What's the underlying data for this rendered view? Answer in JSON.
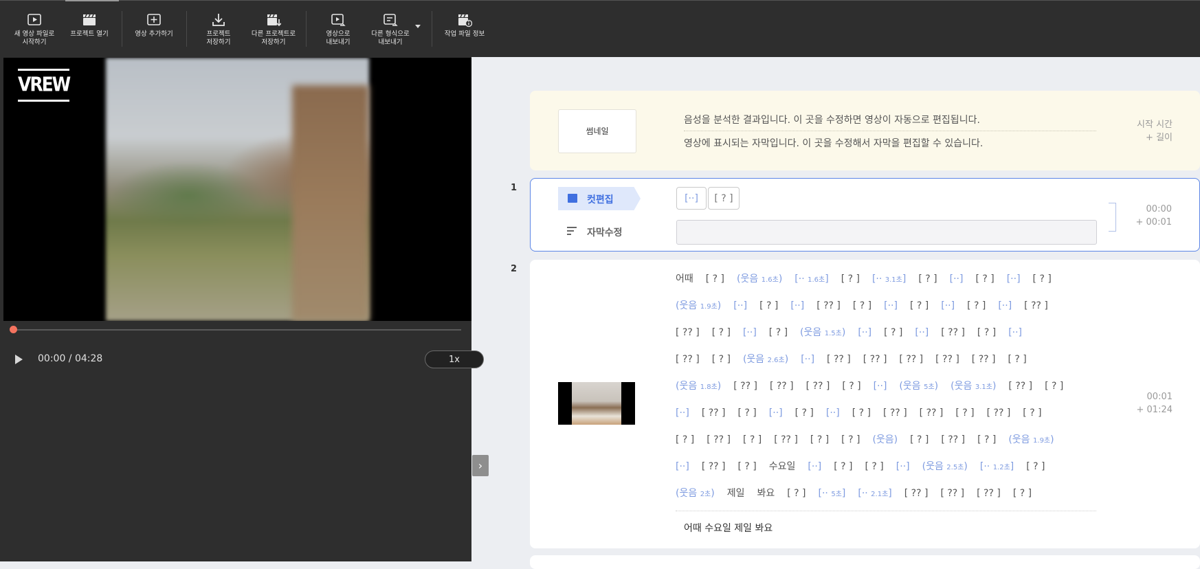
{
  "toolbar": {
    "items": [
      {
        "name": "new-video-button",
        "label": "새 영상 파일로\n시작하기",
        "icon": "play-box-icon"
      },
      {
        "name": "open-project-button",
        "label": "프로젝트 열기",
        "icon": "clapper-icon"
      },
      {
        "name": "add-video-button",
        "label": "영상 추가하기",
        "icon": "plus-box-icon"
      },
      {
        "name": "save-project-button",
        "label": "프로젝트\n저장하기",
        "icon": "download-icon"
      },
      {
        "name": "save-as-button",
        "label": "다른 프로젝트로\n저장하기",
        "icon": "clapper-download-icon"
      },
      {
        "name": "export-video-button",
        "label": "영상으로\n내보내기",
        "icon": "export-video-icon"
      },
      {
        "name": "export-other-button",
        "label": "다른 형식으로\n내보내기",
        "icon": "export-format-icon"
      },
      {
        "name": "project-info-button",
        "label": "작업 파일 정보",
        "icon": "clapper-info-icon"
      }
    ]
  },
  "player": {
    "logo": "VREW",
    "time": "00:00 / 04:28",
    "speed": "1x",
    "progress": 0
  },
  "header": {
    "thumbnail_label": "썸네일",
    "line1": "음성을 분석한 결과입니다. 이 곳을 수정하면 영상이 자동으로 편집됩니다.",
    "line2": "영상에 표시되는 자막입니다. 이 곳을 수정해서 자막을 편집할 수 있습니다.",
    "start_time": "시작 시간",
    "length": "+ 길이"
  },
  "clip1": {
    "number": "1",
    "cut_label": "컷편집",
    "subtitle_label": "자막수정",
    "chips": [
      "[··]",
      "[ ? ]"
    ],
    "start": "00:00",
    "length": "+ 00:01"
  },
  "clip2": {
    "number": "2",
    "start": "00:01",
    "length": "+ 01:24",
    "subtitle": "어때 수요일 제일 봐요",
    "lines": [
      [
        [
          "어때",
          ""
        ],
        [
          "[ ? ]",
          ""
        ],
        [
          "(웃음 |1.6초|)",
          "g"
        ],
        [
          "[·· |1.6초|]",
          "g"
        ],
        [
          "[ ? ]",
          ""
        ],
        [
          "[·· |3.1초|]",
          "g"
        ],
        [
          "[ ? ]",
          ""
        ],
        [
          "[··]",
          "g"
        ],
        [
          "[ ? ]",
          ""
        ],
        [
          "[··]",
          "g"
        ],
        [
          "[ ? ]",
          ""
        ]
      ],
      [
        [
          "(웃음 |1.9초|)",
          "g"
        ],
        [
          "[··]",
          "g"
        ],
        [
          "[ ? ]",
          ""
        ],
        [
          "[··]",
          "g"
        ],
        [
          "[ ?? ]",
          ""
        ],
        [
          "[ ? ]",
          ""
        ],
        [
          "[··]",
          "g"
        ],
        [
          "[ ? ]",
          ""
        ],
        [
          "[··]",
          "g"
        ],
        [
          "[ ? ]",
          ""
        ],
        [
          "[··]",
          "g"
        ],
        [
          "[ ?? ]",
          ""
        ]
      ],
      [
        [
          "[ ?? ]",
          ""
        ],
        [
          "[ ? ]",
          ""
        ],
        [
          "[··]",
          "g"
        ],
        [
          "[ ? ]",
          ""
        ],
        [
          "(웃음 |1.5초|)",
          "g"
        ],
        [
          "[··]",
          "g"
        ],
        [
          "[ ? ]",
          ""
        ],
        [
          "[··]",
          "g"
        ],
        [
          "[ ?? ]",
          ""
        ],
        [
          "[ ? ]",
          ""
        ],
        [
          "[··]",
          "g"
        ]
      ],
      [
        [
          "[ ?? ]",
          ""
        ],
        [
          "[ ? ]",
          ""
        ],
        [
          "(웃음 |2.6초|)",
          "g"
        ],
        [
          "[··]",
          "g"
        ],
        [
          "[ ?? ]",
          ""
        ],
        [
          "[ ?? ]",
          ""
        ],
        [
          "[ ?? ]",
          ""
        ],
        [
          "[ ?? ]",
          ""
        ],
        [
          "[ ?? ]",
          ""
        ],
        [
          "[ ? ]",
          ""
        ]
      ],
      [
        [
          "(웃음 |1.8초|)",
          "g"
        ],
        [
          "[ ?? ]",
          ""
        ],
        [
          "[ ?? ]",
          ""
        ],
        [
          "[ ?? ]",
          ""
        ],
        [
          "[ ? ]",
          ""
        ],
        [
          "[··]",
          "g"
        ],
        [
          "(웃음 |5초|)",
          "g"
        ],
        [
          "(웃음 |3.1초|)",
          "g"
        ],
        [
          "[ ?? ]",
          ""
        ],
        [
          "[ ? ]",
          ""
        ]
      ],
      [
        [
          "[··]",
          "g"
        ],
        [
          "[ ?? ]",
          ""
        ],
        [
          "[ ? ]",
          ""
        ],
        [
          "[··]",
          "g"
        ],
        [
          "[ ? ]",
          ""
        ],
        [
          "[··]",
          "g"
        ],
        [
          "[ ? ]",
          ""
        ],
        [
          "[ ?? ]",
          ""
        ],
        [
          "[ ?? ]",
          ""
        ],
        [
          "[ ? ]",
          ""
        ],
        [
          "[ ?? ]",
          ""
        ],
        [
          "[ ? ]",
          ""
        ]
      ],
      [
        [
          "[ ? ]",
          ""
        ],
        [
          "[ ?? ]",
          ""
        ],
        [
          "[ ? ]",
          ""
        ],
        [
          "[ ?? ]",
          ""
        ],
        [
          "[ ? ]",
          ""
        ],
        [
          "[ ? ]",
          ""
        ],
        [
          "(웃음)",
          "g"
        ],
        [
          "[ ? ]",
          ""
        ],
        [
          "[ ?? ]",
          ""
        ],
        [
          "[ ? ]",
          ""
        ],
        [
          "(웃음 |1.9초|)",
          "g"
        ]
      ],
      [
        [
          "[··]",
          "g"
        ],
        [
          "[ ?? ]",
          ""
        ],
        [
          "[ ? ]",
          ""
        ],
        [
          "수요일",
          ""
        ],
        [
          "[··]",
          "g"
        ],
        [
          "[ ? ]",
          ""
        ],
        [
          "[ ? ]",
          ""
        ],
        [
          "[··]",
          "g"
        ],
        [
          "(웃음 |2.5초|)",
          "g"
        ],
        [
          "[·· |1.2초|]",
          "g"
        ],
        [
          "[ ? ]",
          ""
        ]
      ],
      [
        [
          "(웃음 |2초|)",
          "g"
        ],
        [
          "제일",
          ""
        ],
        [
          "봐요",
          ""
        ],
        [
          "[ ? ]",
          ""
        ],
        [
          "[·· |5초|]",
          "g"
        ],
        [
          "[·· |2.1초|]",
          "g"
        ],
        [
          "[ ?? ]",
          ""
        ],
        [
          "[ ?? ]",
          ""
        ],
        [
          "[ ?? ]",
          ""
        ],
        [
          "[ ? ]",
          ""
        ]
      ]
    ]
  }
}
